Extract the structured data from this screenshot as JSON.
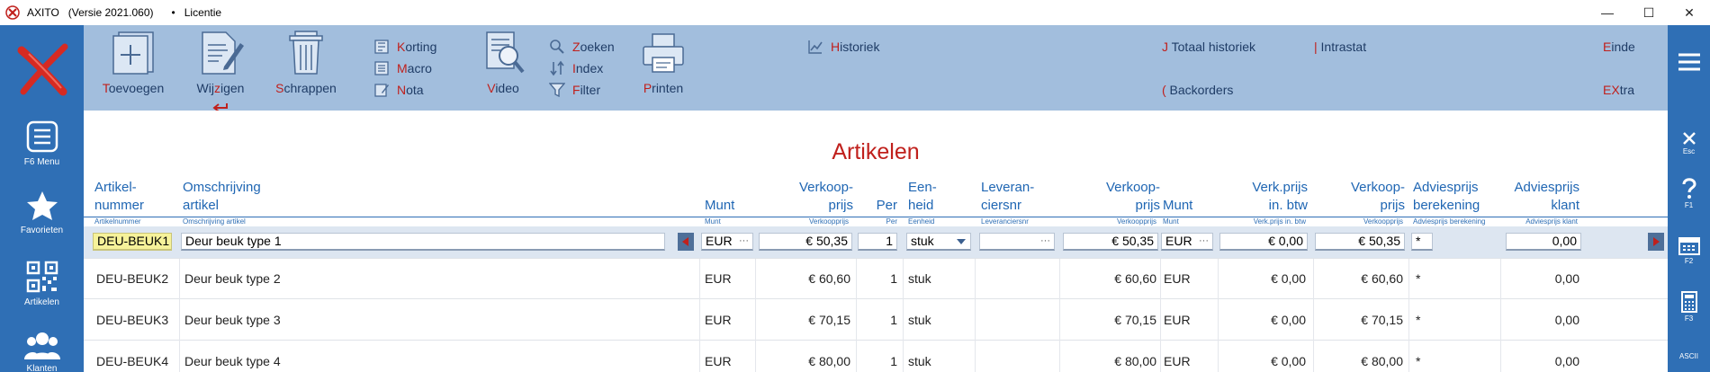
{
  "window": {
    "app_title": "AXITO",
    "version": "(Versie 2021.060)",
    "bullet": "•",
    "license": "Licentie",
    "minimize": "—",
    "maximize": "☐",
    "close": "✕"
  },
  "colors": {
    "accent_blue": "#2f6fb5",
    "toolbar_bg": "#a2bedd",
    "hotkey_red": "#c0201c",
    "header_blue": "#1f66b3",
    "key_field_yellow": "#f6f29a"
  },
  "leftbar": {
    "items": [
      {
        "label": "",
        "icon": "axito-logo-icon"
      },
      {
        "label": "F6 Menu",
        "icon": "menu-icon"
      },
      {
        "label": "Favorieten",
        "icon": "star-icon"
      },
      {
        "label": "Artikelen",
        "icon": "qr-code-icon"
      },
      {
        "label": "Klanten",
        "icon": "users-icon"
      }
    ]
  },
  "rightbar": {
    "items": [
      {
        "label": "",
        "icon": "hamburger-icon"
      },
      {
        "label": "Esc",
        "icon": "close-icon"
      },
      {
        "label": "F1",
        "icon": "help-icon"
      },
      {
        "label": "F2",
        "icon": "calendar-icon"
      },
      {
        "label": "F3",
        "icon": "calculator-icon"
      },
      {
        "label": "ASCII",
        "icon": "ascii-icon"
      }
    ]
  },
  "toolbar": {
    "add": {
      "hot": "T",
      "rest": "oevoegen"
    },
    "edit": {
      "pre": "Wij",
      "hot": "z",
      "rest": "igen"
    },
    "delete": {
      "hot": "S",
      "rest": "chrappen"
    },
    "discount": {
      "hot": "K",
      "rest": "orting"
    },
    "macro": {
      "hot": "M",
      "rest": "acro"
    },
    "note": {
      "hot": "N",
      "rest": "ota"
    },
    "video": {
      "hot": "V",
      "rest": "ideo"
    },
    "search": {
      "hot": "Z",
      "rest": "oeken"
    },
    "index": {
      "hot": "I",
      "rest": "ndex"
    },
    "filter": {
      "hot": "F",
      "rest": "ilter"
    },
    "print": {
      "hot": "P",
      "rest": "rinten"
    },
    "history": {
      "hot": "H",
      "rest": "istoriek"
    },
    "total_history": {
      "hot": "J",
      "rest": " Totaal historiek"
    },
    "intrastat": {
      "hot": "|",
      "rest": " Intrastat"
    },
    "end": {
      "hot": "E",
      "rest": "inde"
    },
    "backorders": {
      "hot": "(",
      "rest": " Backorders"
    },
    "extra": {
      "hot": "EX",
      "rest": "tra"
    }
  },
  "page_title": "Artikelen",
  "columns": {
    "artikelnummer": [
      "Artikel-",
      "nummer"
    ],
    "omschrijving": [
      "Omschrijving",
      "artikel"
    ],
    "munt": [
      "",
      "Munt"
    ],
    "verkoopprijs": [
      "Verkoop-",
      "prijs"
    ],
    "per": [
      "",
      "Per"
    ],
    "eenheid": [
      "Een-",
      "heid"
    ],
    "leveranciersnr": [
      "Leveran-",
      "ciersnr"
    ],
    "verkoopprijs2": [
      "Verkoop-",
      "prijs"
    ],
    "munt2": [
      "",
      "Munt"
    ],
    "verkprijs_btw": [
      "Verk.prijs",
      "in. btw"
    ],
    "verkoopprijs3": [
      "Verkoop-",
      "prijs"
    ],
    "adviesprijs_ber": [
      "Adviesprijs",
      "berekening"
    ],
    "adviesprijs_klant": [
      "Adviesprijs",
      "klant"
    ]
  },
  "mini_labels": {
    "artikelnummer": "Artikelnummer",
    "omschrijving": "Omschrijving artikel",
    "munt": "Munt",
    "verkoopprijs": "Verkoopprijs",
    "per": "Per",
    "eenheid": "Eenheid",
    "leveranciersnr": "Leveranciersnr",
    "verkoopprijs2": "Verkoopprijs",
    "munt2": "Munt",
    "verkprijs_btw": "Verk.prijs in. btw",
    "verkoopprijs3": "Verkoopprijs",
    "adviesprijs_ber": "Adviesprijs berekening",
    "adviesprijs_klant": "Adviesprijs klant"
  },
  "edit_row": {
    "artikelnummer": "DEU-BEUK1",
    "omschrijving": "Deur beuk type 1",
    "munt": "EUR",
    "dots": "···",
    "verkoopprijs": "€ 50,35",
    "per": "1",
    "eenheid": "stuk",
    "leveranciersnr": "",
    "verkoopprijs2": "€ 50,35",
    "munt2": "EUR",
    "verkprijs_btw": "€ 0,00",
    "verkoopprijs3": "€ 50,35",
    "adviesprijs_ber": "*",
    "adviesprijs_klant": "0,00"
  },
  "rows": [
    {
      "artikelnummer": "DEU-BEUK2",
      "omschrijving": "Deur beuk type 2",
      "munt": "EUR",
      "verkoopprijs": "€ 60,60",
      "per": "1",
      "eenheid": "stuk",
      "verkoopprijs2": "€ 60,60",
      "munt2": "EUR",
      "verkprijs_btw": "€ 0,00",
      "verkoopprijs3": "€ 60,60",
      "adviesprijs_ber": "*",
      "adviesprijs_klant": "0,00"
    },
    {
      "artikelnummer": "DEU-BEUK3",
      "omschrijving": "Deur beuk type 3",
      "munt": "EUR",
      "verkoopprijs": "€ 70,15",
      "per": "1",
      "eenheid": "stuk",
      "verkoopprijs2": "€ 70,15",
      "munt2": "EUR",
      "verkprijs_btw": "€ 0,00",
      "verkoopprijs3": "€ 70,15",
      "adviesprijs_ber": "*",
      "adviesprijs_klant": "0,00"
    },
    {
      "artikelnummer": "DEU-BEUK4",
      "omschrijving": "Deur beuk type 4",
      "munt": "EUR",
      "verkoopprijs": "€ 80,00",
      "per": "1",
      "eenheid": "stuk",
      "verkoopprijs2": "€ 80,00",
      "munt2": "EUR",
      "verkprijs_btw": "€ 0,00",
      "verkoopprijs3": "€ 80,00",
      "adviesprijs_ber": "*",
      "adviesprijs_klant": "0,00"
    }
  ]
}
